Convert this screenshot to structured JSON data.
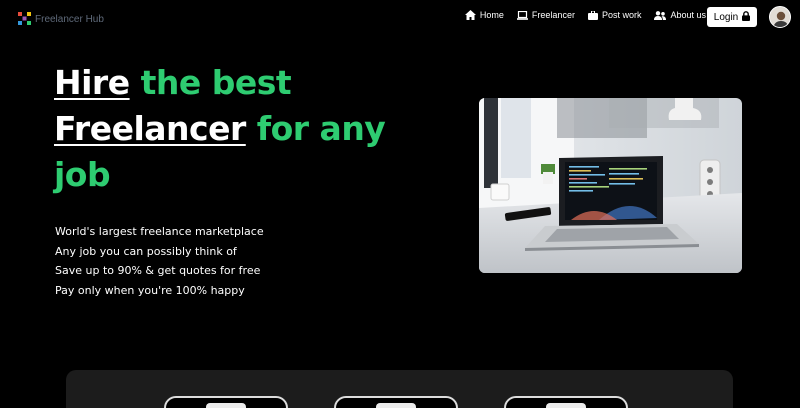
{
  "nav": {
    "brand": "Freelancer Hub",
    "links": [
      {
        "label": "Home",
        "icon": "home-icon"
      },
      {
        "label": "Freelancer",
        "icon": "laptop-icon"
      },
      {
        "label": "Post work",
        "icon": "briefcase-icon"
      },
      {
        "label": "About us",
        "icon": "users-icon"
      }
    ],
    "login_label": "Login"
  },
  "hero": {
    "title_word_1": "Hire",
    "title_text_1": " the best ",
    "title_word_2": "Freelancer",
    "title_text_2": " for any job",
    "lines": [
      "World's largest freelance marketplace",
      "Any job you can possibly think of",
      "Save up to 90% & get quotes for free",
      "Pay only when you're 100% happy"
    ],
    "image_icon": "laptop-workspace-photo"
  },
  "colors": {
    "accent": "#2ecc71",
    "background": "#000000",
    "panel": "#1c1c1c"
  }
}
